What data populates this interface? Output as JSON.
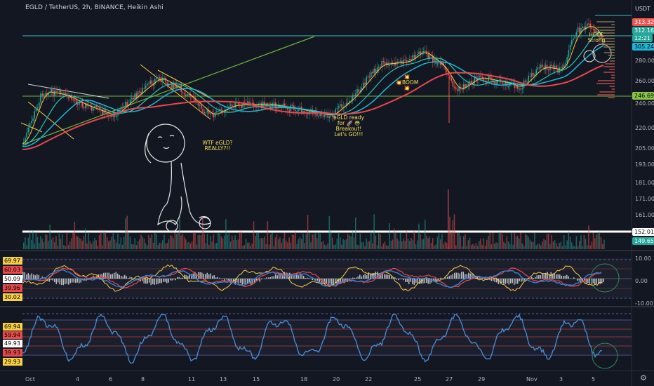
{
  "header": {
    "title": "EGLD / TetherUS, 2h, BINANCE, Heikin Ashi",
    "currency": "USDT"
  },
  "colors": {
    "background": "#131722",
    "up": "#26a69a",
    "down": "#ef5350",
    "ema_fast": "#f7c948",
    "ema_mid": "#2ec4b6",
    "ema_cyan": "#1fb6d6",
    "ema_slow": "#e8474c",
    "trend_line": "#6fb23d",
    "level_line": "#3fbfbf",
    "rsi_line": "#f7d046",
    "osc_line": "#3f7fcf",
    "stoch_line": "#4a8fd8"
  },
  "price_axis": [
    "313.32",
    "312.16",
    "12:21",
    "305.24",
    "280.00",
    "260.00",
    "246.69",
    "240.00",
    "220.00",
    "205.00",
    "193.00",
    "181.00",
    "171.00",
    "161.00",
    "152.01",
    "149.65"
  ],
  "price_badges": [
    {
      "label": "313.32",
      "bg": "#ef5350",
      "fg": "#ffffff"
    },
    {
      "label": "312.16",
      "bg": "#26a69a",
      "fg": "#ffffff"
    },
    {
      "label": "12:21",
      "bg": "#26a69a",
      "fg": "#ffffff"
    },
    {
      "label": "305.24",
      "bg": "#1fb6d6",
      "fg": "#000000"
    },
    {
      "label": "246.69",
      "bg": "#8bc34a",
      "fg": "#000000"
    },
    {
      "label": "152.01",
      "bg": "#ffffff",
      "fg": "#000000"
    },
    {
      "label": "149.65",
      "bg": "#26a69a",
      "fg": "#ffffff"
    }
  ],
  "x_axis": [
    "Oct",
    "4",
    "6",
    "8",
    "11",
    "13",
    "15",
    "18",
    "20",
    "22",
    "25",
    "27",
    "29",
    "Nov",
    "3",
    "5"
  ],
  "annotations": {
    "wtf": [
      "WTF eGLD?",
      "REALLY?!!"
    ],
    "breakout": [
      "eGLD ready",
      "for 🚀 😳",
      "Breakout!",
      "Let's GO!!!"
    ],
    "boom": [
      "💥",
      "💥BOOM 💥"
    ],
    "hodl": [
      "HODL",
      "Strong"
    ]
  },
  "panel1": {
    "left_badges": [
      {
        "label": "69.97",
        "bg": "#f7d046"
      },
      {
        "label": "60.03",
        "bg": "#e84b4b"
      },
      {
        "label": "50.09",
        "bg": "#ffffff"
      },
      {
        "label": "39.96",
        "bg": "#e84b4b"
      },
      {
        "label": "30.02",
        "bg": "#f7d046"
      }
    ],
    "right_axis": [
      "10.00",
      "0.00",
      "-10.00"
    ]
  },
  "panel2": {
    "left_badges": [
      {
        "label": "69.94",
        "bg": "#f7d046"
      },
      {
        "label": "59.94",
        "bg": "#e84b4b"
      },
      {
        "label": "49.93",
        "bg": "#ffffff"
      },
      {
        "label": "39.93",
        "bg": "#e84b4b"
      },
      {
        "label": "29.93",
        "bg": "#f7d046"
      }
    ]
  }
}
